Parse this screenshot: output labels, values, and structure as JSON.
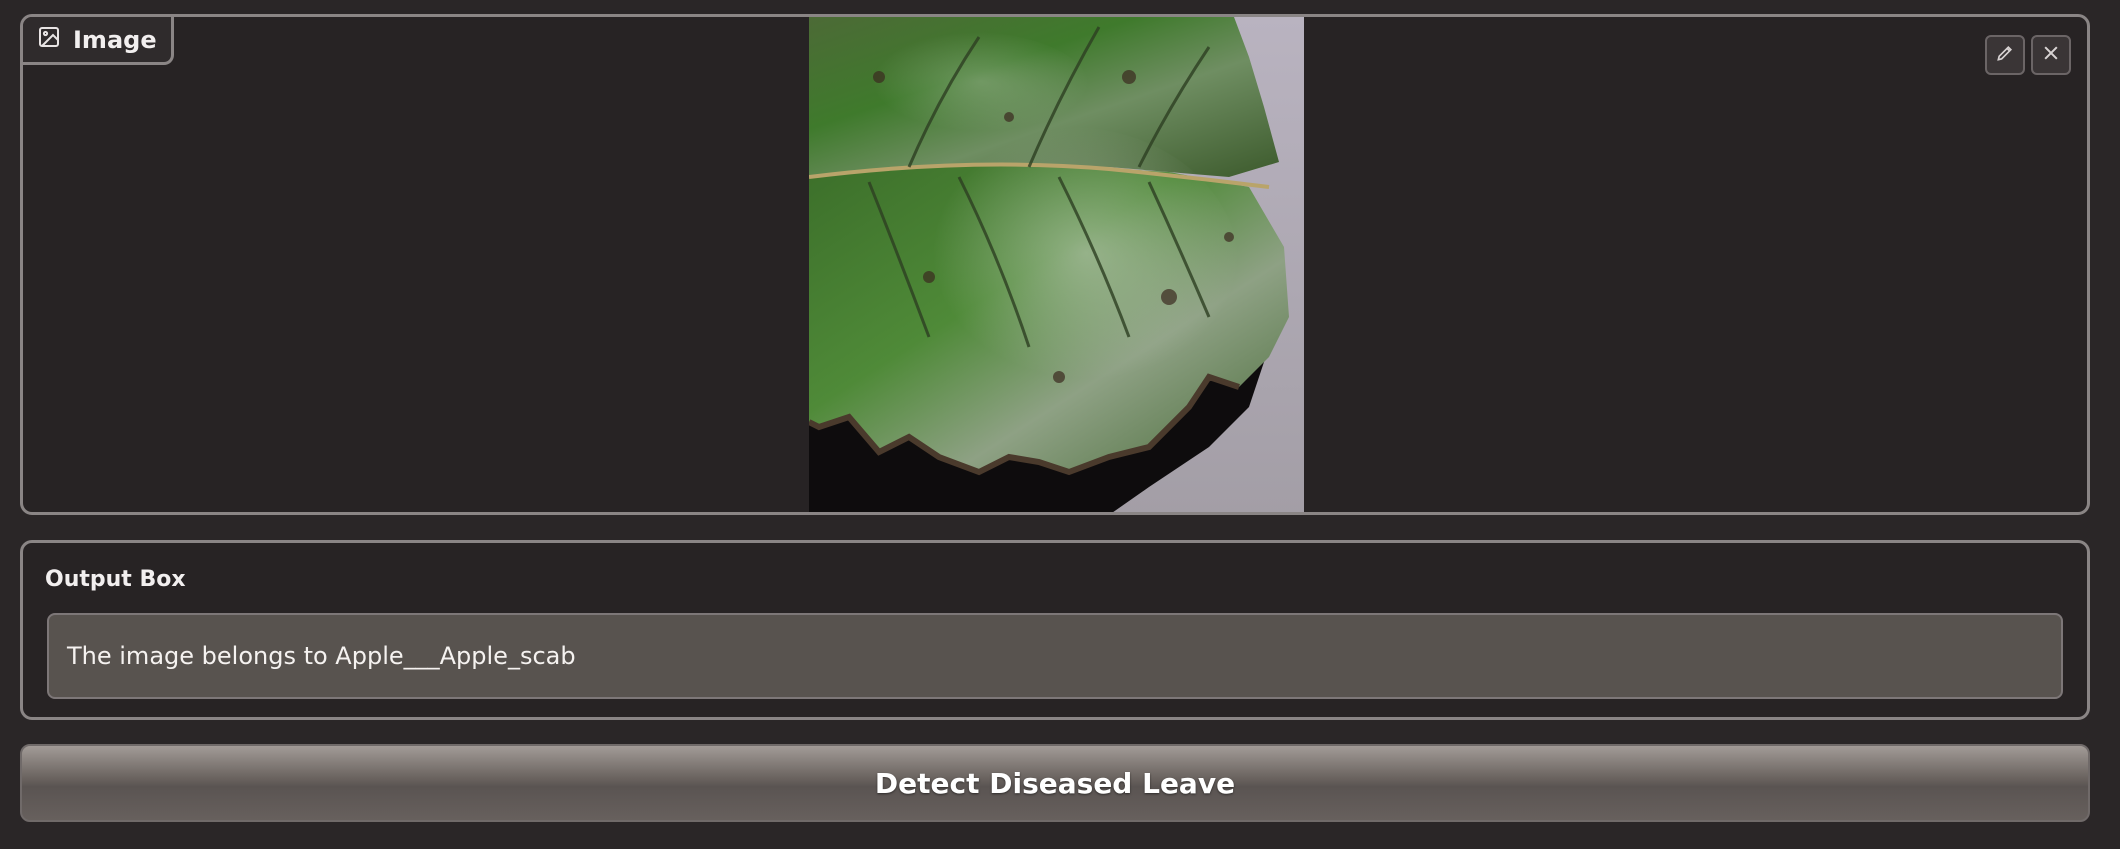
{
  "image_panel": {
    "label": "Image",
    "label_icon": "image-icon",
    "edit_icon": "pencil-icon",
    "close_icon": "close-icon",
    "photo_subject": "apple-leaf-scab"
  },
  "output_panel": {
    "label": "Output Box",
    "value": "The image belongs to Apple___Apple_scab"
  },
  "action": {
    "button_label": "Detect Diseased Leave"
  },
  "colors": {
    "background": "#2a2627",
    "panel_border": "#8a8585",
    "output_fill": "#58534f",
    "button_top": "#a29b97",
    "button_bottom": "#5a5452"
  }
}
